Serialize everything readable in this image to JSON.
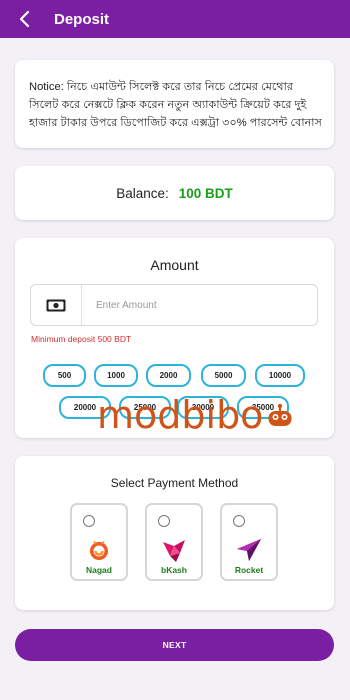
{
  "header": {
    "title": "Deposit",
    "back_icon": "chevron-left-icon"
  },
  "notice": {
    "text": "Notice: নিচে এমাউন্ট সিলেক্ট করে তার নিচে প্রেমের মেথোর সিলেট করে নেক্সটে ক্লিক করেন নতুন অ্যাকাউন্ট ক্রিয়েট করে দুই হাজার টাকার উপরে ডিপোজিট করে এক্সট্রা ৩০% পারসেন্ট বোনাস"
  },
  "balance": {
    "label": "Balance:",
    "value": "100 BDT"
  },
  "amount": {
    "title": "Amount",
    "icon": "cash-icon",
    "placeholder": "Enter Amount",
    "minimum_text": "Minimum deposit 500 BDT",
    "chips_row1": [
      "500",
      "1000",
      "2000",
      "5000",
      "10000"
    ],
    "chips_row2": [
      "20000",
      "25000",
      "30000",
      "35000"
    ]
  },
  "watermark": {
    "text": "modbibo"
  },
  "payment": {
    "title": "Select Payment Method",
    "methods": [
      {
        "name": "Nagad",
        "icon": "nagad-logo-icon"
      },
      {
        "name": "bKash",
        "icon": "bkash-logo-icon"
      },
      {
        "name": "Rocket",
        "icon": "rocket-logo-icon"
      }
    ]
  },
  "next_button": {
    "label": "NEXT"
  },
  "colors": {
    "primary": "#7b1fa2",
    "balance": "#1a9e1a",
    "chip_border": "#2bb3d9",
    "error": "#d32f2f",
    "watermark": "#d05418"
  }
}
